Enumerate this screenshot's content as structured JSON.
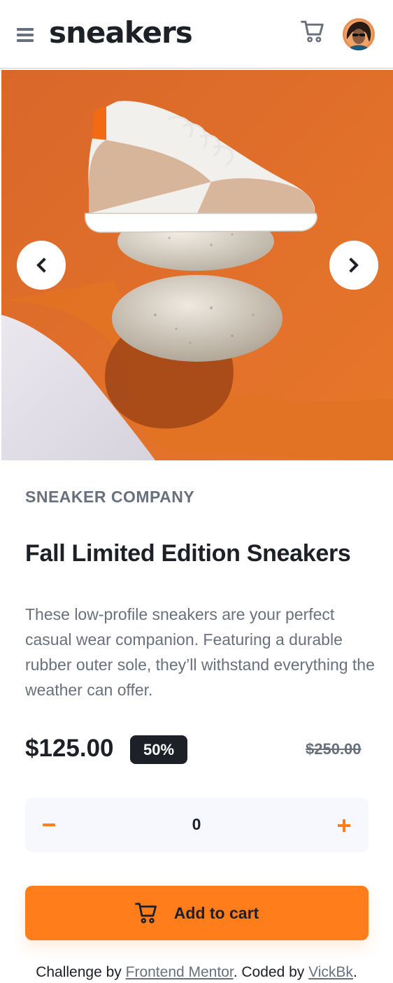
{
  "header": {
    "logo": "sneakers",
    "menu_icon": "hamburger-menu-icon",
    "cart_icon": "cart-icon",
    "avatar_icon": "user-avatar"
  },
  "gallery": {
    "prev_icon": "chevron-left-icon",
    "next_icon": "chevron-right-icon"
  },
  "product": {
    "company": "SNEAKER COMPANY",
    "title": "Fall Limited Edition Sneakers",
    "description": "These low-profile sneakers are your perfect casual wear companion. Featuring a durable rubber outer sole, they’ll withstand everything the weather can offer.",
    "price": "$125.00",
    "discount": "50%",
    "original_price": "$250.00"
  },
  "quantity": {
    "value": "0",
    "minus_icon": "minus-icon",
    "plus_icon": "plus-icon"
  },
  "add_to_cart": {
    "label": "Add to cart",
    "icon": "cart-icon"
  },
  "footer": {
    "prefix": "Challenge by ",
    "mentor_link": "Frontend Mentor",
    "middle": ". Coded by ",
    "author_link": "VickBk",
    "suffix": "."
  },
  "colors": {
    "accent": "#ff7e1b",
    "dark": "#1d2026",
    "muted": "#69707d",
    "light_bg": "#f6f8fd"
  }
}
